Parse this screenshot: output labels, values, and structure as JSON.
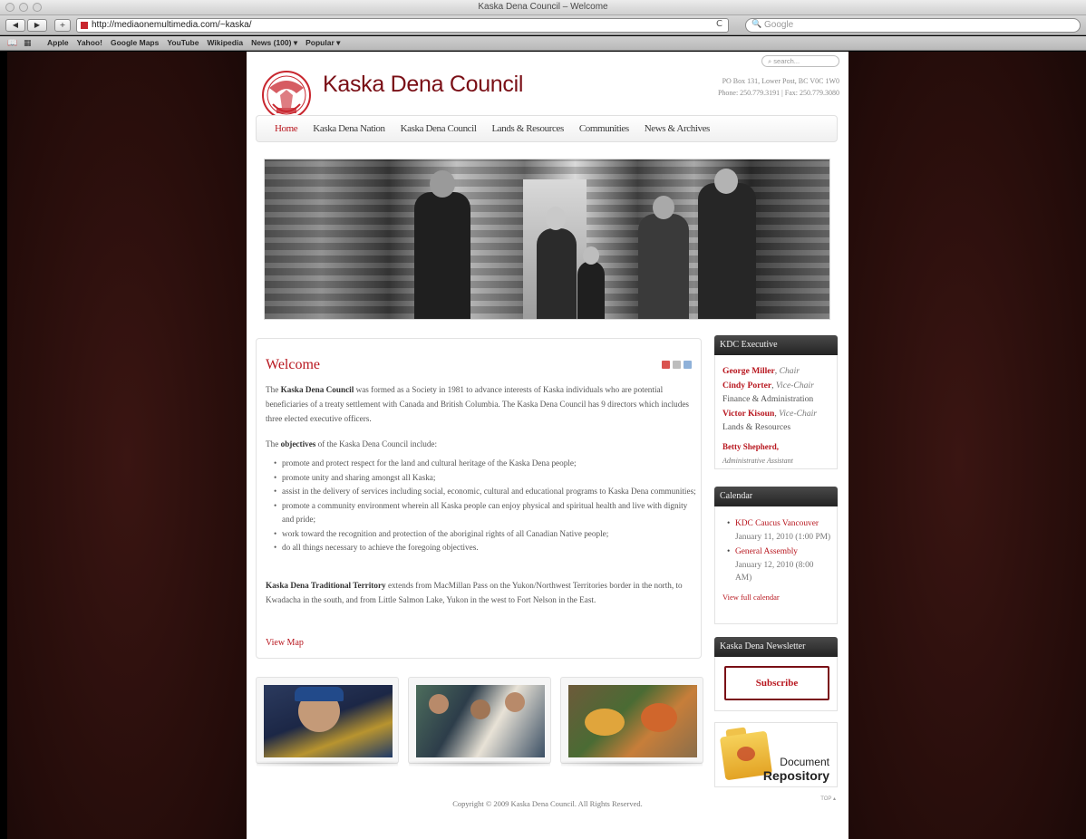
{
  "browser": {
    "window_title": "Kaska Dena Council – Welcome",
    "url": "http://mediaonemultimedia.com/~kaska/",
    "search_placeholder": "Google",
    "back_glyph": "◀",
    "forward_glyph": "▶",
    "add_glyph": "+",
    "reload_glyph": "C",
    "bookmarks": [
      "Apple",
      "Yahoo!",
      "Google Maps",
      "YouTube",
      "Wikipedia",
      "News (100) ▾",
      "Popular ▾"
    ]
  },
  "header": {
    "site_name": "Kaska Dena Council",
    "search_placeholder": "search...",
    "address_line1": "PO Box 131, Lower Post, BC V0C 1W0",
    "address_line2": "Phone: 250.779.3191 | Fax: 250.779.3080"
  },
  "nav": [
    {
      "label": "Home",
      "active": true
    },
    {
      "label": "Kaska Dena Nation",
      "active": false
    },
    {
      "label": "Kaska Dena Council",
      "active": false
    },
    {
      "label": "Lands & Resources",
      "active": false
    },
    {
      "label": "Communities",
      "active": false
    },
    {
      "label": "News & Archives",
      "active": false
    }
  ],
  "welcome": {
    "title": "Welcome",
    "intro_bold": "Kaska Dena Council",
    "intro_prefix": "The ",
    "intro_rest": " was formed as a Society in 1981 to advance interests of Kaska individuals who are potential beneficiaries of a treaty settlement with Canada and British Columbia. The Kaska Dena Council has 9 directors which includes three elected executive officers.",
    "objectives_prefix": "The ",
    "objectives_bold": "objectives",
    "objectives_rest": " of the Kaska Dena Council  include:",
    "objectives": [
      "promote and protect respect for the land and cultural heritage of the Kaska Dena people;",
      "promote unity and sharing amongst all Kaska;",
      "assist in the delivery of services including social, economic, cultural and educational programs to Kaska Dena communities;",
      "promote a community environment wherein all Kaska people can enjoy physical and spiritual health and live with dignity and pride;",
      "work toward the recognition and protection of the aboriginal rights of all Canadian Native people;",
      "do all things necessary to achieve the foregoing objectives."
    ],
    "territory_bold": "Kaska Dena Traditional Territory",
    "territory_rest": " extends from MacMillan Pass on the Yukon/Northwest Territories border in the north, to Kwadacha in the south, and from Little Salmon Lake, Yukon in the west to Fort Nelson in the East.",
    "view_map": "View Map"
  },
  "executive": {
    "heading": "KDC Executive",
    "members": [
      {
        "name": "George Miller",
        "role": "Chair",
        "extra": ""
      },
      {
        "name": "Cindy Porter",
        "role": "Vice-Chair",
        "extra": "Finance & Administration"
      },
      {
        "name": "Victor Kisoun",
        "role": "Vice-Chair",
        "extra": "Lands & Resources"
      }
    ],
    "assistant_name": "Betty Shepherd,",
    "assistant_role": "Administrative Assistant"
  },
  "calendar": {
    "heading": "Calendar",
    "events": [
      {
        "title": "KDC Caucus Vancouver",
        "date": "January 11, 2010 (1:00 PM)"
      },
      {
        "title": "General Assembly",
        "date": "January 12, 2010 (8:00 AM)"
      }
    ],
    "view_full": "View full calendar"
  },
  "newsletter": {
    "heading": "Kaska Dena Newsletter",
    "subscribe": "Subscribe"
  },
  "document_repository": {
    "line1": "Document",
    "line2": "Repository"
  },
  "footer": {
    "copyright": "Copyright © 2009 Kaska Dena Council. All Rights Reserved.",
    "top": "TOP ▴"
  },
  "colors": {
    "accent": "#b8171f",
    "brand": "#7a0f16"
  }
}
